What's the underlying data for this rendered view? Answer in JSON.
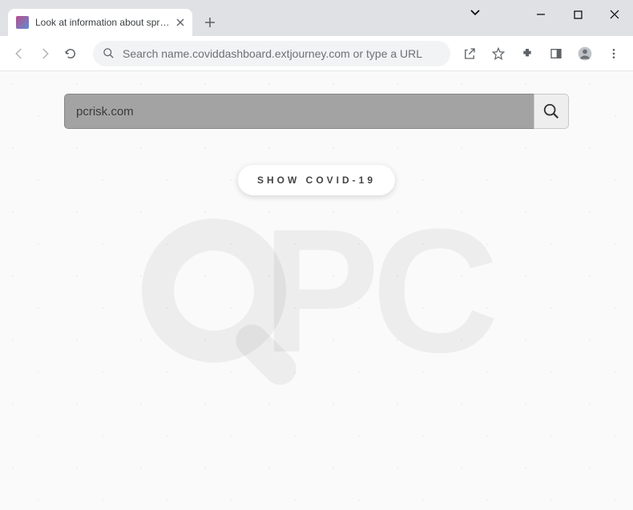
{
  "window": {
    "tab_title": "Look at information about spread…",
    "omnibox_text": "Search name.coviddashboard.extjourney.com or type a URL"
  },
  "page": {
    "search_value": "pcrisk.com",
    "show_button_label": "SHOW COVID-19",
    "watermark_text": "PC"
  }
}
